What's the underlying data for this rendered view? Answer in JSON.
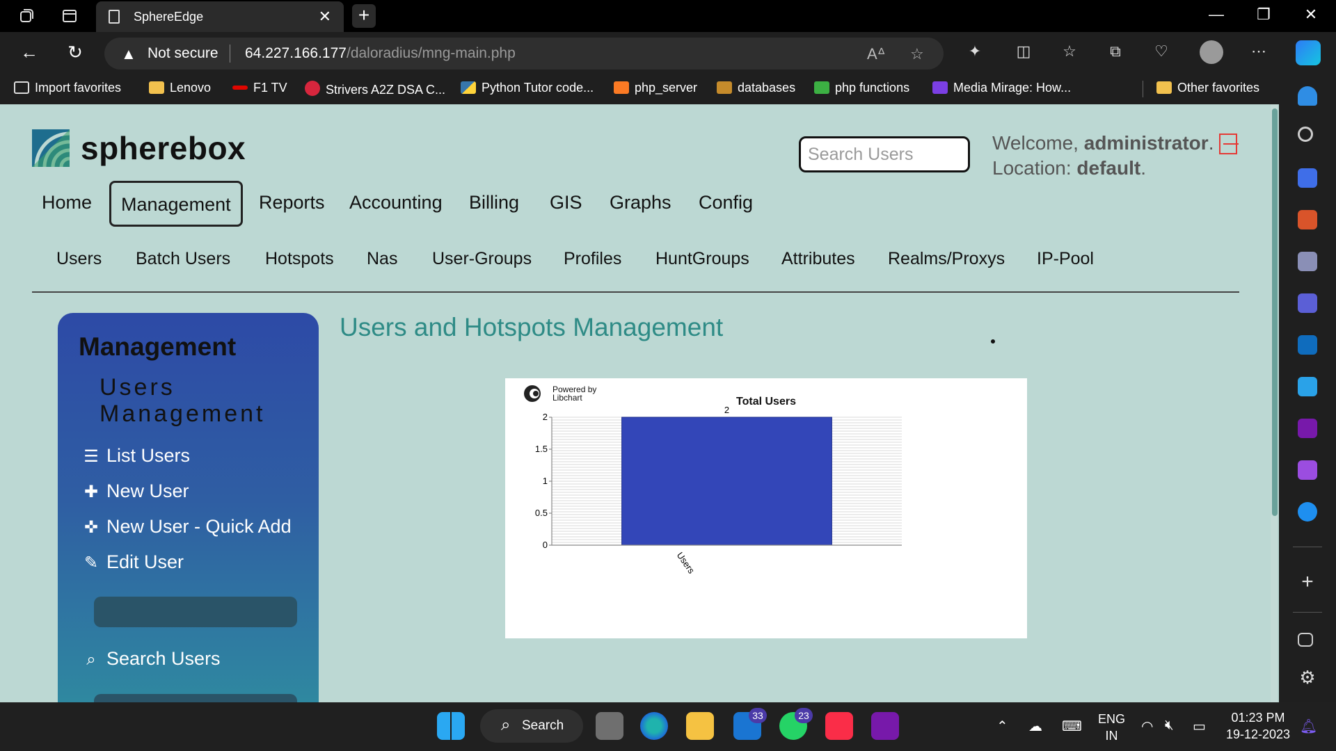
{
  "browser": {
    "tab_title": "SphereEdge",
    "security_label": "Not secure",
    "url_host": "64.227.166.177",
    "url_path": "/daloradius/mng-main.php",
    "favorites": [
      {
        "label": "Import favorites",
        "color": "#1f1f1f"
      },
      {
        "label": "Lenovo",
        "color": "#f2c14e"
      },
      {
        "label": "F1 TV",
        "color": "#e10600"
      },
      {
        "label": "Strivers A2Z DSA C...",
        "color": "#d7263d"
      },
      {
        "label": "Python Tutor code...",
        "color": "#3776ab"
      },
      {
        "label": "php_server",
        "color": "#fb7a24"
      },
      {
        "label": "databases",
        "color": "#c58b2b"
      },
      {
        "label": "php functions",
        "color": "#3cb043"
      },
      {
        "label": "Media Mirage: How...",
        "color": "#7b3fe4"
      }
    ],
    "other_favorites": "Other favorites"
  },
  "site": {
    "logo_text": "spherebox",
    "search_placeholder": "Search Users",
    "welcome_label": "Welcome,",
    "user": "administrator",
    "location_label": "Location:",
    "location": "default",
    "main_nav": [
      "Home",
      "Management",
      "Reports",
      "Accounting",
      "Billing",
      "GIS",
      "Graphs",
      "Config"
    ],
    "active_nav": "Management",
    "sub_nav": [
      "Users",
      "Batch Users",
      "Hotspots",
      "Nas",
      "User-Groups",
      "Profiles",
      "HuntGroups",
      "Attributes",
      "Realms/Proxys",
      "IP-Pool"
    ]
  },
  "sidebar": {
    "title": "Management",
    "subtitle": "Users Management",
    "items": [
      {
        "label": "List Users",
        "icon": "list-icon"
      },
      {
        "label": "New User",
        "icon": "plus-icon"
      },
      {
        "label": "New User - Quick Add",
        "icon": "move-plus-icon"
      },
      {
        "label": "Edit User",
        "icon": "pencil-icon"
      },
      {
        "label": "Search Users",
        "icon": "search-doc-icon"
      }
    ]
  },
  "main": {
    "heading": "Users and Hotspots Management"
  },
  "chart_data": {
    "type": "bar",
    "title": "Total Users",
    "powered_by": "Powered by",
    "libchart": "Libchart",
    "categories": [
      "Users"
    ],
    "values": [
      2
    ],
    "data_labels": [
      "2"
    ],
    "ylim": [
      0,
      2
    ],
    "yticks": [
      "0",
      "0.5",
      "1",
      "1.5",
      "2"
    ],
    "grid": true,
    "bar_color": "#3346b8"
  },
  "taskbar": {
    "search_label": "Search",
    "mail_badge": "33",
    "whatsapp_badge": "23",
    "lang_top": "ENG",
    "lang_bottom": "IN",
    "time": "01:23 PM",
    "date": "19-12-2023"
  }
}
